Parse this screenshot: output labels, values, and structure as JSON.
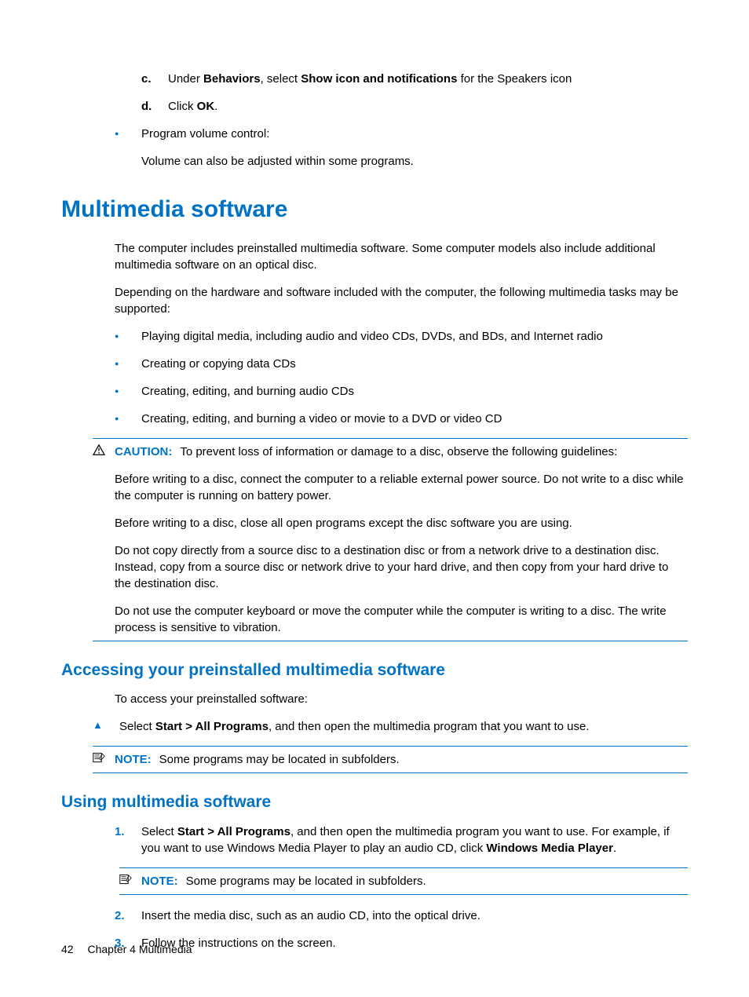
{
  "top": {
    "step_c_marker": "c.",
    "step_c_pre": "Under ",
    "step_c_b1": "Behaviors",
    "step_c_mid": ", select ",
    "step_c_b2": "Show icon and notifications",
    "step_c_post": " for the Speakers icon",
    "step_d_marker": "d.",
    "step_d_pre": "Click ",
    "step_d_b1": "OK",
    "step_d_post": ".",
    "prog_vol": "Program volume control:",
    "prog_vol_text": "Volume can also be adjusted within some programs."
  },
  "h1": "Multimedia software",
  "p1": "The computer includes preinstalled multimedia software. Some computer models also include additional multimedia software on an optical disc.",
  "p2": "Depending on the hardware and software included with the computer, the following multimedia tasks may be supported:",
  "bullets": {
    "b1": "Playing digital media, including audio and video CDs, DVDs, and BDs, and Internet radio",
    "b2": "Creating or copying data CDs",
    "b3": "Creating, editing, and burning audio CDs",
    "b4": "Creating, editing, and burning a video or movie to a DVD or video CD"
  },
  "caution": {
    "label": "CAUTION:",
    "lead": "To prevent loss of information or damage to a disc, observe the following guidelines:",
    "p1": "Before writing to a disc, connect the computer to a reliable external power source. Do not write to a disc while the computer is running on battery power.",
    "p2": "Before writing to a disc, close all open programs except the disc software you are using.",
    "p3": "Do not copy directly from a source disc to a destination disc or from a network drive to a destination disc. Instead, copy from a source disc or network drive to your hard drive, and then copy from your hard drive to the destination disc.",
    "p4": "Do not use the computer keyboard or move the computer while the computer is writing to a disc. The write process is sensitive to vibration."
  },
  "h2a": "Accessing your preinstalled multimedia software",
  "access_intro": "To access your preinstalled software:",
  "access_step_pre": "Select ",
  "access_step_b": "Start > All Programs",
  "access_step_post": ", and then open the multimedia program that you want to use.",
  "note1_label": "NOTE:",
  "note1_text": "Some programs may be located in subfolders.",
  "h2b": "Using multimedia software",
  "use": {
    "m1": "1.",
    "s1_pre": "Select ",
    "s1_b1": "Start > All Programs",
    "s1_mid": ", and then open the multimedia program you want to use. For example, if you want to use Windows Media Player to play an audio CD, click ",
    "s1_b2": "Windows Media Player",
    "s1_post": ".",
    "note_label": "NOTE:",
    "note_text": "Some programs may be located in subfolders.",
    "m2": "2.",
    "s2": "Insert the media disc, such as an audio CD, into the optical drive.",
    "m3": "3.",
    "s3": "Follow the instructions on the screen."
  },
  "footer": {
    "page": "42",
    "chapter": "Chapter 4   Multimedia"
  }
}
